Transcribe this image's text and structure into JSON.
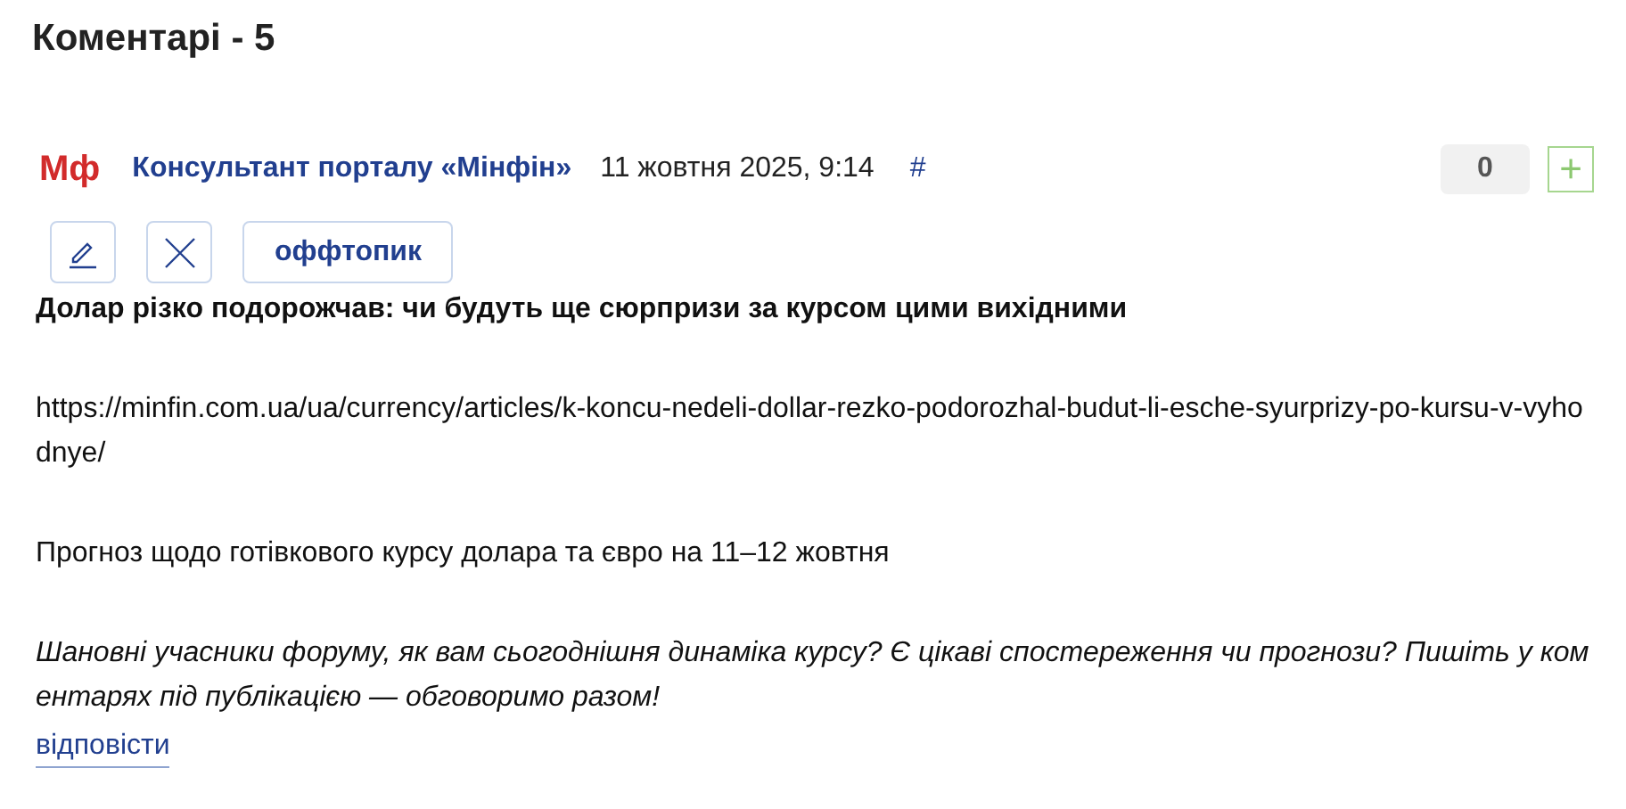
{
  "heading": "Коментарі - 5",
  "comment": {
    "logo": "Мф",
    "author": "Консультант порталу «Мінфін»",
    "date": "11 жовтня 2025, 9:14",
    "anchor": "#",
    "score": "0",
    "plus": "+",
    "actions": [
      {
        "kind": "edit"
      },
      {
        "kind": "delete"
      },
      {
        "kind": "text",
        "label": "оффтопик"
      }
    ],
    "paragraphs": [
      {
        "kind": "bold",
        "text": "Долар різко подорожчав: чи будуть ще сюрпризи за курсом цими вихідними"
      },
      {
        "kind": "plain",
        "text": "https://minfin.com.ua/ua/currency/articles/k-koncu-nedeli-dollar-rezko-podorozhal-budut-li-esche-syurprizy-po-kursu-v-vyhodnye/"
      },
      {
        "kind": "plain",
        "text": "Прогноз щодо готівкового курсу долара та євро на 11–12 жовтня"
      },
      {
        "kind": "italic",
        "text": "Шановні учасники форуму, як вам сьогоднішня динаміка курсу? Є цікаві спостереження чи прогнози? Пишіть у коментарях під публікацією — обговоримо разом!"
      }
    ],
    "reply": "відповісти"
  }
}
